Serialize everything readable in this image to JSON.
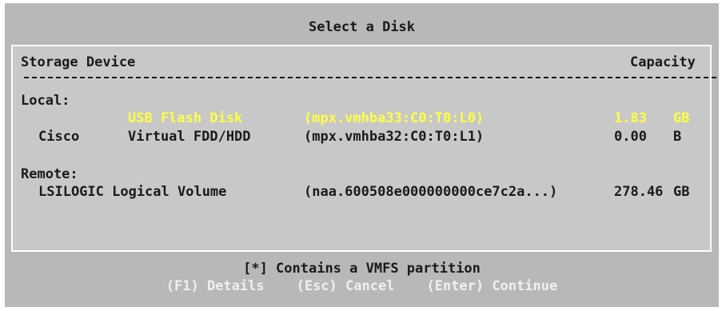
{
  "dialog": {
    "title": "Select a Disk"
  },
  "table": {
    "col_device": "Storage Device",
    "col_capacity": "Capacity",
    "local_label": "Local:",
    "remote_label": "Remote:",
    "local_rows": [
      {
        "vendor": "",
        "model": "USB Flash Disk",
        "id": "(mpx.vmhba33:C0:T0:L0)",
        "size": "1.83",
        "unit": "GB",
        "selected": true
      },
      {
        "vendor": "Cisco",
        "model": "Virtual FDD/HDD",
        "id": "(mpx.vmhba32:C0:T0:L1)",
        "size": "0.00",
        "unit": "B",
        "selected": false
      }
    ],
    "remote_rows": [
      {
        "model": "LSILOGIC Logical Volume",
        "id": "(naa.600508e000000000ce7c2a...)",
        "size": "278.46",
        "unit": "GB"
      }
    ]
  },
  "footer": {
    "vmfs_note": "[*] Contains a VMFS partition",
    "details_key": "(F1) Details",
    "cancel_key": "(Esc) Cancel",
    "continue_key": "(Enter) Continue"
  },
  "colors": {
    "dialog_bg": "#b8b8b8",
    "panel_bg": "#c8c8c8",
    "selected_text": "#ffff44",
    "key_text": "#f0f0f0"
  }
}
